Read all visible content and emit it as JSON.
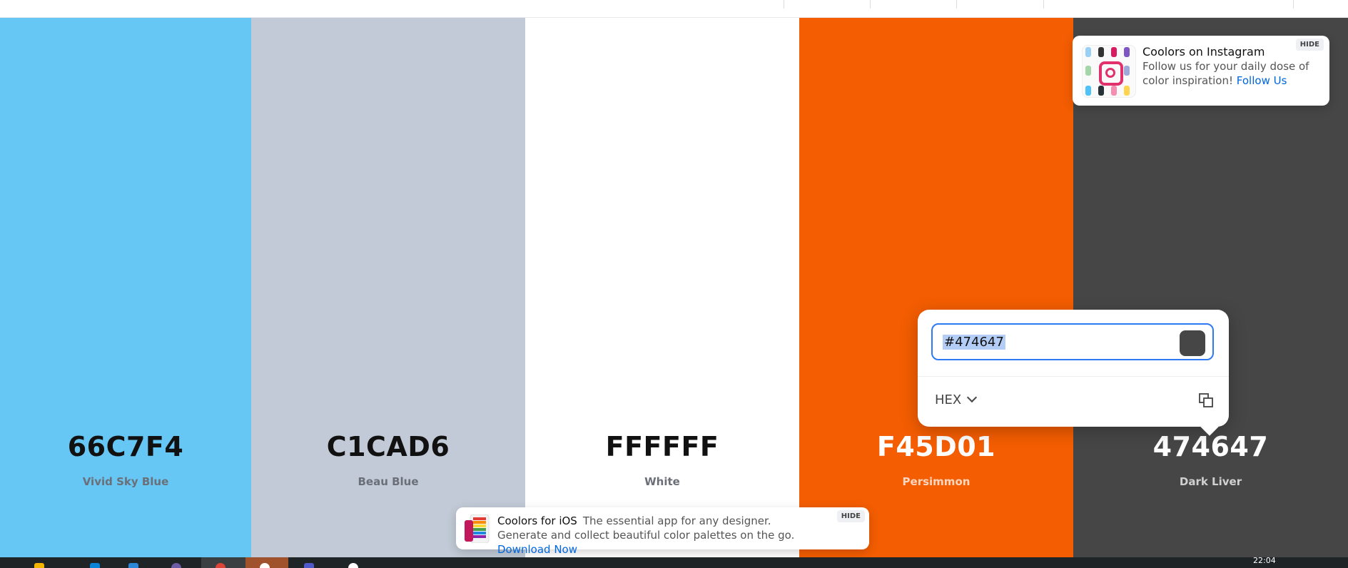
{
  "palette": [
    {
      "hex": "66C7F4",
      "name": "Vivid Sky Blue",
      "color": "#66C7F4",
      "text": "dark"
    },
    {
      "hex": "C1CAD6",
      "name": "Beau Blue",
      "color": "#C1CAD6",
      "text": "dark"
    },
    {
      "hex": "FFFFFF",
      "name": "White",
      "color": "#FFFFFF",
      "text": "dark"
    },
    {
      "hex": "F45D01",
      "name": "Persimmon",
      "color": "#F45D01",
      "text": "light"
    },
    {
      "hex": "474647",
      "name": "Dark Liver",
      "color": "#474647",
      "text": "light"
    }
  ],
  "instagram_notice": {
    "title": "Coolors on Instagram",
    "body": "Follow us for your daily dose of color inspiration!",
    "link": "Follow Us",
    "hide": "HIDE",
    "icon": "instagram-icon"
  },
  "picker": {
    "value": "#474647",
    "format": "HEX",
    "swatch_color": "#474647",
    "copy_icon": "copy-icon",
    "chevron_icon": "chevron-down-icon"
  },
  "ios_notice": {
    "title": "Coolors for iOS",
    "body": "The essential app for any designer. Generate and collect beautiful color palettes on the go.",
    "link": "Download Now",
    "hide": "HIDE"
  },
  "taskbar": {
    "clock": "22:04"
  }
}
